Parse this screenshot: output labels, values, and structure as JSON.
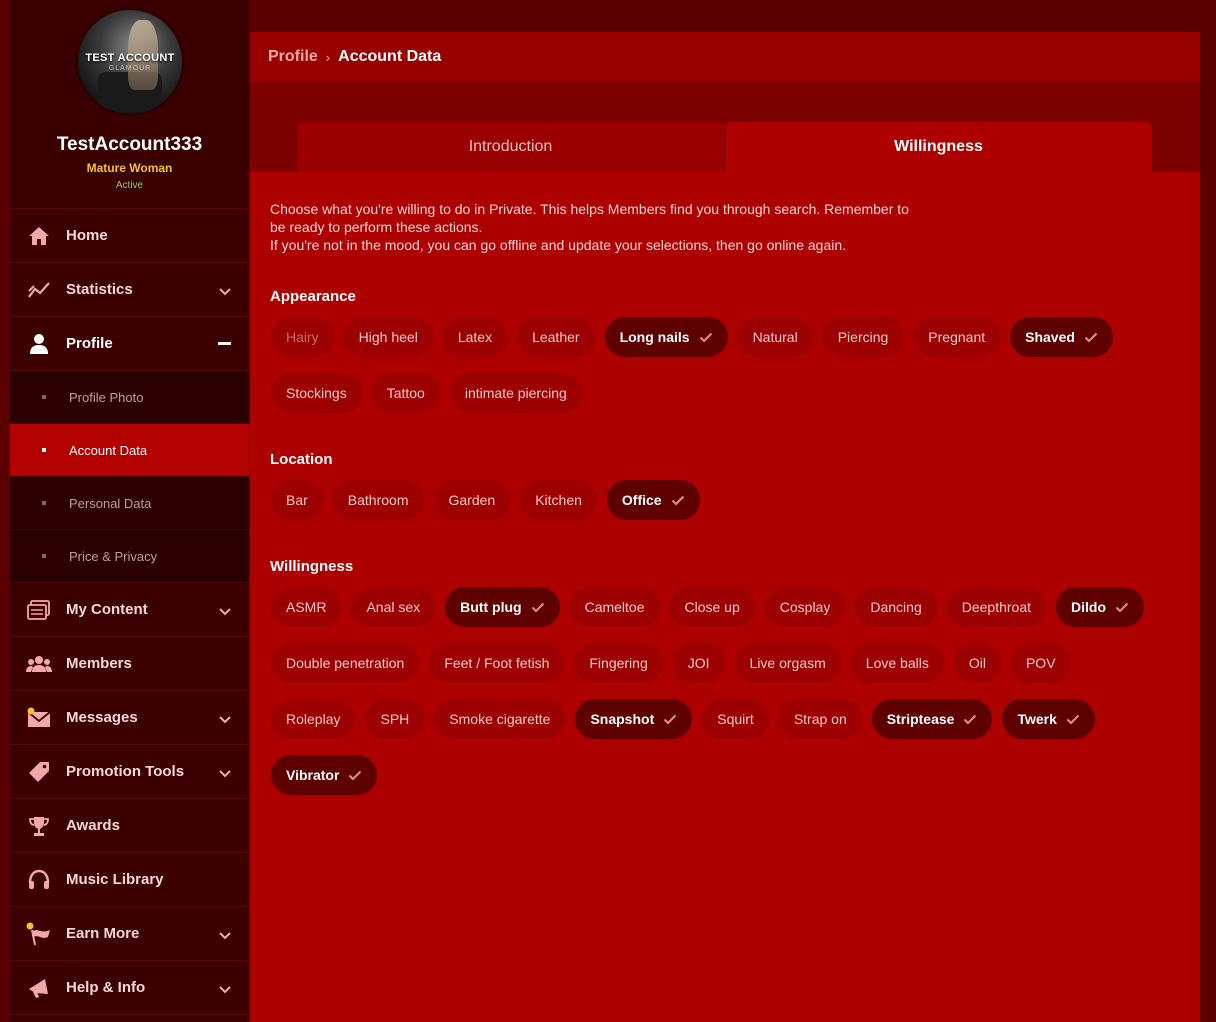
{
  "profile": {
    "watermark_title": "TEST ACCOUNT",
    "watermark_sub": "GLAMOUR",
    "username": "TestAccount333",
    "role": "Mature Woman",
    "status": "Active"
  },
  "nav": {
    "home": "Home",
    "statistics": "Statistics",
    "profile": "Profile",
    "profile_photo": "Profile Photo",
    "account_data": "Account Data",
    "personal_data": "Personal Data",
    "price_privacy": "Price & Privacy",
    "my_content": "My Content",
    "members": "Members",
    "messages": "Messages",
    "promotion_tools": "Promotion Tools",
    "awards": "Awards",
    "music_library": "Music Library",
    "earn_more": "Earn More",
    "help_info": "Help & Info"
  },
  "breadcrumb": {
    "parent": "Profile",
    "separator": "›",
    "current": "Account Data"
  },
  "tabs": {
    "introduction": "Introduction",
    "willingness": "Willingness"
  },
  "intro": {
    "line1": "Choose what you're willing to do in Private. This helps Members find you through search. Remember to",
    "line2": "be ready to perform these actions.",
    "line3": "If you're not in the mood, you can go offline and update your selections, then go online again."
  },
  "sections": {
    "appearance": {
      "title": "Appearance",
      "tags": [
        {
          "label": "Hairy",
          "selected": false
        },
        {
          "label": "High heel",
          "selected": false
        },
        {
          "label": "Latex",
          "selected": false
        },
        {
          "label": "Leather",
          "selected": false
        },
        {
          "label": "Long nails",
          "selected": true
        },
        {
          "label": "Natural",
          "selected": false
        },
        {
          "label": "Piercing",
          "selected": false
        },
        {
          "label": "Pregnant",
          "selected": false
        },
        {
          "label": "Shaved",
          "selected": true
        },
        {
          "label": "Stockings",
          "selected": false
        },
        {
          "label": "Tattoo",
          "selected": false
        },
        {
          "label": "intimate piercing",
          "selected": false
        }
      ]
    },
    "location": {
      "title": "Location",
      "tags": [
        {
          "label": "Bar",
          "selected": false
        },
        {
          "label": "Bathroom",
          "selected": false
        },
        {
          "label": "Garden",
          "selected": false
        },
        {
          "label": "Kitchen",
          "selected": false
        },
        {
          "label": "Office",
          "selected": true
        }
      ]
    },
    "willingness": {
      "title": "Willingness",
      "tags": [
        {
          "label": "ASMR",
          "selected": false
        },
        {
          "label": "Anal sex",
          "selected": false
        },
        {
          "label": "Butt plug",
          "selected": true
        },
        {
          "label": "Cameltoe",
          "selected": false
        },
        {
          "label": "Close up",
          "selected": false
        },
        {
          "label": "Cosplay",
          "selected": false
        },
        {
          "label": "Dancing",
          "selected": false
        },
        {
          "label": "Deepthroat",
          "selected": false
        },
        {
          "label": "Dildo",
          "selected": true
        },
        {
          "label": "Double penetration",
          "selected": false
        },
        {
          "label": "Feet / Foot fetish",
          "selected": false
        },
        {
          "label": "Fingering",
          "selected": false
        },
        {
          "label": "JOI",
          "selected": false
        },
        {
          "label": "Live orgasm",
          "selected": false
        },
        {
          "label": "Love balls",
          "selected": false
        },
        {
          "label": "Oil",
          "selected": false
        },
        {
          "label": "POV",
          "selected": false
        },
        {
          "label": "Roleplay",
          "selected": false
        },
        {
          "label": "SPH",
          "selected": false
        },
        {
          "label": "Smoke cigarette",
          "selected": false
        },
        {
          "label": "Snapshot",
          "selected": true
        },
        {
          "label": "Squirt",
          "selected": false
        },
        {
          "label": "Strap on",
          "selected": false
        },
        {
          "label": "Striptease",
          "selected": true
        },
        {
          "label": "Twerk",
          "selected": true
        },
        {
          "label": "Vibrator",
          "selected": true
        }
      ]
    }
  },
  "colors": {
    "accent": "#b30000",
    "panel": "#ad0000",
    "selected_tag": "#5e0000",
    "role": "#f2c230",
    "status": "#8fd14f"
  },
  "icons": {
    "home": "home-icon",
    "statistics": "chart-line-icon",
    "profile": "user-icon",
    "my_content": "content-icon",
    "members": "users-icon",
    "messages": "envelope-icon",
    "promotion_tools": "tag-icon",
    "awards": "trophy-icon",
    "music_library": "headphones-icon",
    "earn_more": "flag-icon",
    "help_info": "megaphone-icon"
  }
}
